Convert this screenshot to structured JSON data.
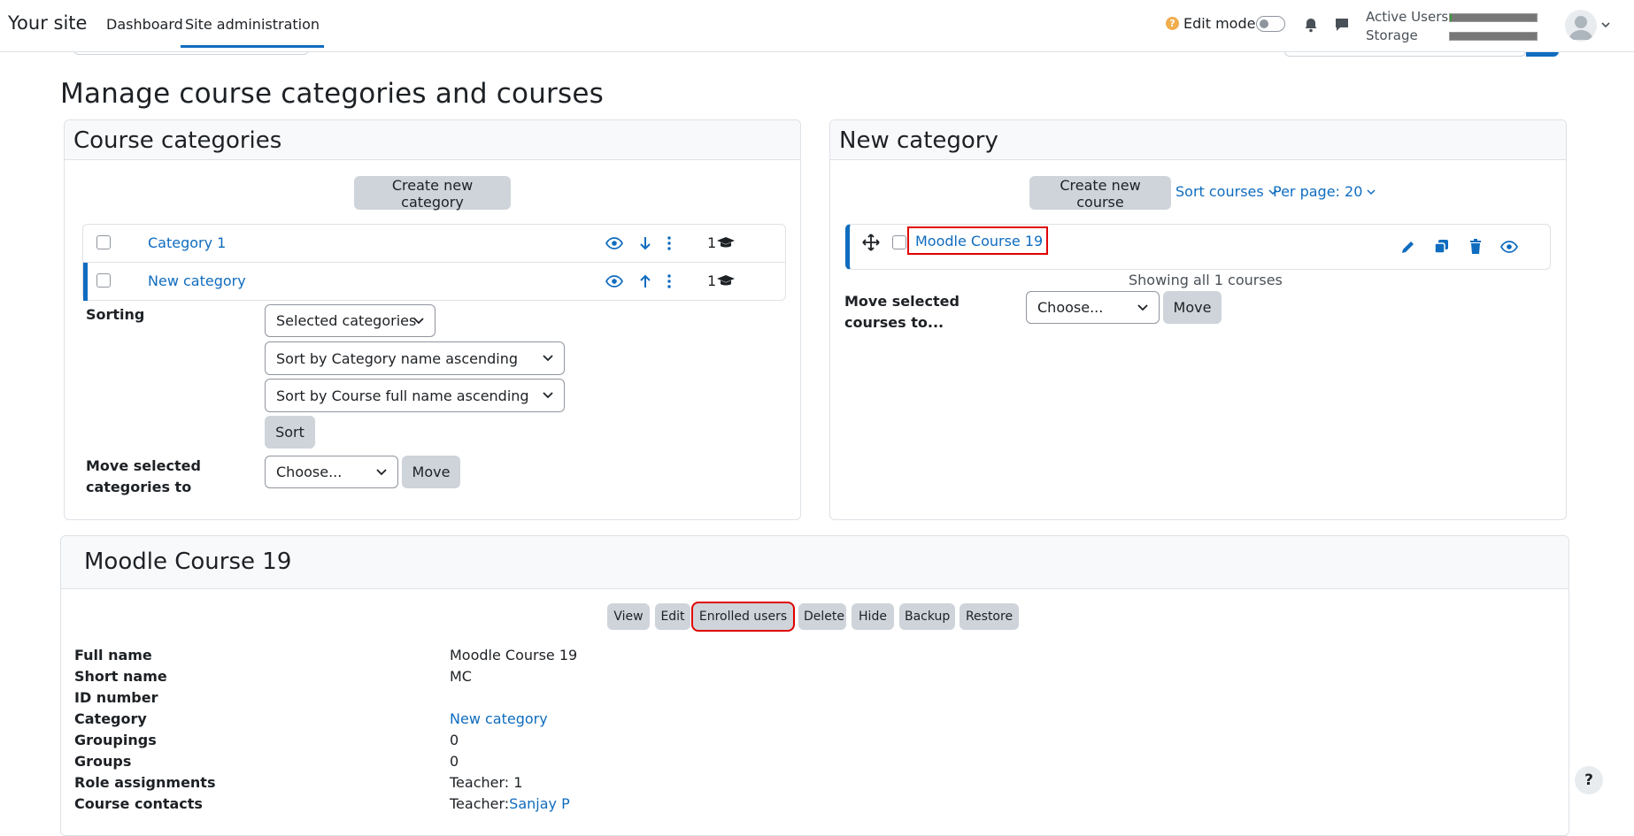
{
  "navbar": {
    "brand": "Your site",
    "links": [
      "Dashboard",
      "Site administration"
    ],
    "edit_mode_label": "Edit mode",
    "edit_mode_on": false,
    "usage": [
      {
        "label": "Active Users",
        "fraction": 0.02
      },
      {
        "label": "Storage",
        "fraction": 0.0
      }
    ]
  },
  "page_title": "Manage course categories and courses",
  "categories_panel": {
    "title": "Course categories",
    "create_button": "Create new category",
    "items": [
      {
        "name": "Category 1",
        "count": "1",
        "selected": false,
        "arrow": "down"
      },
      {
        "name": "New category",
        "count": "1",
        "selected": true,
        "arrow": "up"
      }
    ],
    "sorting_label": "Sorting",
    "sort_selects": [
      "Selected categories",
      "Sort by Category name ascending",
      "Sort by Course full name ascending"
    ],
    "sort_button": "Sort",
    "move_label": "Move selected categories to",
    "move_select": "Choose...",
    "move_button": "Move"
  },
  "courses_panel": {
    "title": "New category",
    "create_button": "Create new course",
    "sort_link": "Sort courses",
    "perpage_link": "Per page: 20",
    "course_name": "Moodle Course 19",
    "showing_text": "Showing all 1 courses",
    "move_label": "Move selected courses to...",
    "move_select": "Choose...",
    "move_button": "Move"
  },
  "course_detail": {
    "title": "Moodle Course 19",
    "actions": [
      "View",
      "Edit",
      "Enrolled users",
      "Delete",
      "Hide",
      "Backup",
      "Restore"
    ],
    "rows": [
      {
        "label": "Full name",
        "value": "Moodle Course 19"
      },
      {
        "label": "Short name",
        "value": "MC"
      },
      {
        "label": "ID number",
        "value": ""
      },
      {
        "label": "Category",
        "value": "New category"
      },
      {
        "label": "Groupings",
        "value": "0"
      },
      {
        "label": "Groups",
        "value": "0"
      },
      {
        "label": "Role assignments",
        "value": "Teacher: 1"
      }
    ],
    "contacts_label": "Course contacts",
    "contacts_prefix": "Teacher:",
    "contacts_name": "Sanjay P"
  },
  "help_button": "?",
  "colors": {
    "accent": "#0f6cbf",
    "highlight": "#e00000",
    "button": "#ced4da"
  }
}
